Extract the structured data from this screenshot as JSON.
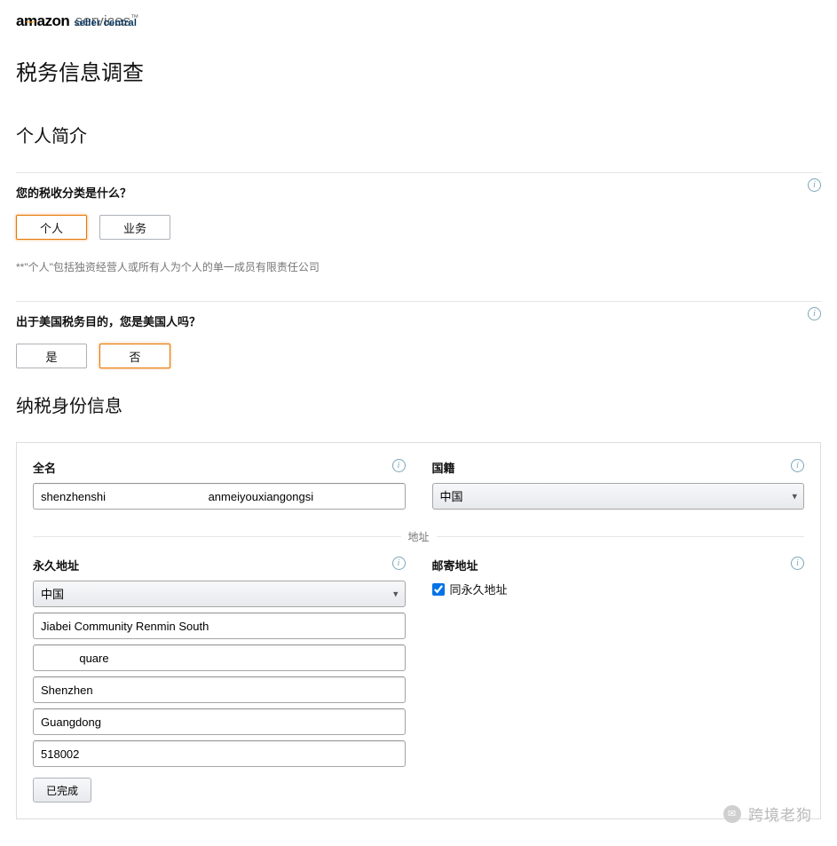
{
  "logo": {
    "brand": "amazon",
    "services": "services",
    "subbrand": "seller central"
  },
  "page_title": "税务信息调查",
  "section_profile": "个人简介",
  "q1": {
    "label": "您的税收分类是什么？",
    "option_individual": "个人",
    "option_business": "业务",
    "helper": "**\"个人\"包括独资经营人或所有人为个人的单一成员有限责任公司"
  },
  "q2": {
    "label": "出于美国税务目的，您是美国人吗？",
    "option_yes": "是",
    "option_no": "否"
  },
  "section_tax_id": "纳税身份信息",
  "identity": {
    "fullname_label": "全名",
    "fullname_value": "shenzhenshi                                anmeiyouxiangongsi",
    "nationality_label": "国籍",
    "nationality_value": "中国"
  },
  "address_divider": "地址",
  "perm_addr": {
    "label": "永久地址",
    "country": "中国",
    "line1": "Jiabei Community Renmin South",
    "line2": "            quare",
    "city": "Shenzhen",
    "province": "Guangdong",
    "postal": "518002",
    "done_button": "已完成"
  },
  "mail_addr": {
    "label": "邮寄地址",
    "same_as_label": "同永久地址",
    "same_as_checked": true
  },
  "watermark": "跨境老狗"
}
